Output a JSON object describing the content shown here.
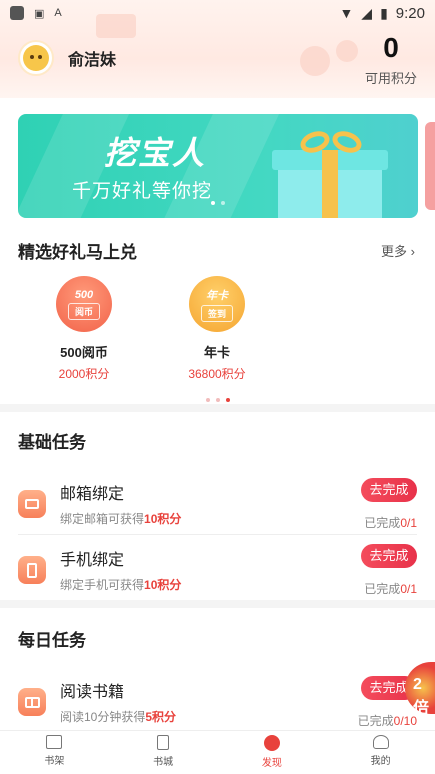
{
  "status_bar": {
    "time": "9:20"
  },
  "header": {
    "username": "俞洁妹",
    "points_value": "0",
    "points_label": "可用积分"
  },
  "banner": {
    "title": "挖宝人",
    "subtitle": "千万好礼等你挖"
  },
  "gifts_section": {
    "title": "精选好礼马上兑",
    "more": "更多",
    "items": [
      {
        "coin_text": "500",
        "coin_tag": "阅币",
        "name": "500阅币",
        "points": "2000积分",
        "color": "#f2634a"
      },
      {
        "coin_text": "年卡",
        "coin_tag": "签到",
        "name": "年卡",
        "points": "36800积分",
        "color": "#f5a531"
      }
    ]
  },
  "basic_tasks": {
    "title": "基础任务",
    "items": [
      {
        "name": "邮箱绑定",
        "desc_prefix": "绑定邮箱可获得",
        "desc_reward": "10积分",
        "button": "去完成",
        "progress_prefix": "已完成",
        "progress_value": "0/1",
        "icon": "mail-icon"
      },
      {
        "name": "手机绑定",
        "desc_prefix": "绑定手机可获得",
        "desc_reward": "10积分",
        "button": "去完成",
        "progress_prefix": "已完成",
        "progress_value": "0/1",
        "icon": "phone-icon"
      }
    ]
  },
  "daily_tasks": {
    "title": "每日任务",
    "items": [
      {
        "name": "阅读书籍",
        "desc_prefix": "阅读10分钟获得",
        "desc_reward": "5积分",
        "button": "去完成",
        "progress_prefix": "已完成",
        "progress_value": "0/10",
        "icon": "book-icon"
      }
    ],
    "badge": "2倍"
  },
  "bottom_nav": [
    {
      "label": "书架",
      "icon": "bookshelf-icon",
      "active": false
    },
    {
      "label": "书城",
      "icon": "bookstore-icon",
      "active": false
    },
    {
      "label": "发现",
      "icon": "discover-icon",
      "active": true
    },
    {
      "label": "我的",
      "icon": "profile-icon",
      "active": false
    }
  ]
}
